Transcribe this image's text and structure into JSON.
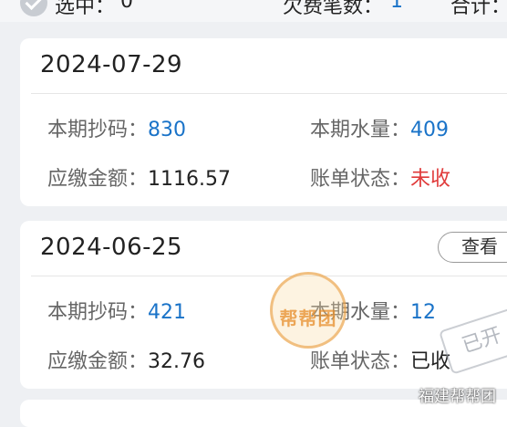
{
  "topbar": {
    "selected_label": "选中：",
    "selected_count": "0",
    "arrears_label": "欠费笔数：",
    "arrears_count": "1",
    "total_label": "合计："
  },
  "bills": [
    {
      "date": "2024-07-29",
      "reading_label": "本期抄码：",
      "reading_value": "830",
      "water_label": "本期水量：",
      "water_value": "409",
      "amount_label": "应缴金额：",
      "amount_value": "1116.57",
      "status_label": "账单状态：",
      "status_value": "未收",
      "status_color": "#e03a3a"
    },
    {
      "date": "2024-06-25",
      "view_label": "查看",
      "reading_label": "本期抄码：",
      "reading_value": "421",
      "water_label": "本期水量：",
      "water_value": "12",
      "amount_label": "应缴金额：",
      "amount_value": "32.76",
      "status_label": "账单状态：",
      "status_value": "已收",
      "status_color": "#222222",
      "stamp_text": "已开"
    }
  ],
  "overlay": {
    "seal_text": "帮帮团",
    "watermark": "福建帮帮团"
  },
  "colors": {
    "accent": "#1a73c8",
    "unpaid": "#e03a3a"
  }
}
